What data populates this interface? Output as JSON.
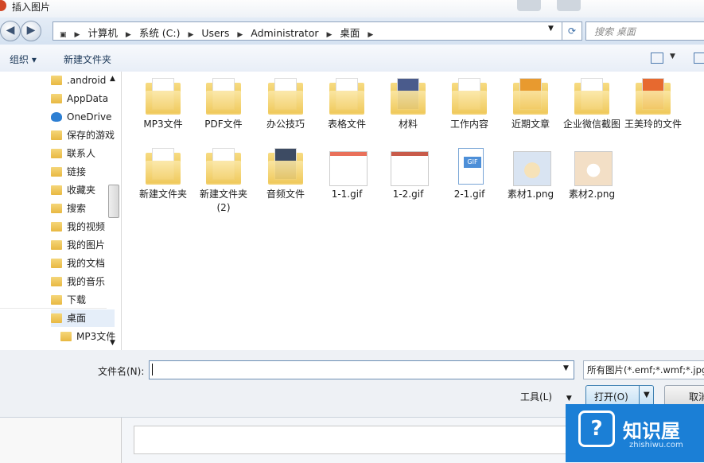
{
  "window": {
    "title": "插入图片"
  },
  "address": {
    "crumbs": [
      "计算机",
      "系统 (C:)",
      "Users",
      "Administrator",
      "桌面"
    ],
    "search_placeholder": "搜索 桌面"
  },
  "toolbar": {
    "organize": "组织 ▾",
    "new_folder": "新建文件夹"
  },
  "nav": {
    "items": [
      {
        "label": ".android",
        "icon": "folder-icon"
      },
      {
        "label": "AppData",
        "icon": "folder-icon"
      },
      {
        "label": "OneDrive",
        "icon": "onedrive-icon"
      },
      {
        "label": "保存的游戏",
        "icon": "folder-icon"
      },
      {
        "label": "联系人",
        "icon": "contacts-icon"
      },
      {
        "label": "链接",
        "icon": "links-icon"
      },
      {
        "label": "收藏夹",
        "icon": "favorites-icon"
      },
      {
        "label": "搜索",
        "icon": "search-folder-icon"
      },
      {
        "label": "我的视频",
        "icon": "folder-icon"
      },
      {
        "label": "我的图片",
        "icon": "folder-icon"
      },
      {
        "label": "我的文档",
        "icon": "folder-icon"
      },
      {
        "label": "我的音乐",
        "icon": "folder-icon"
      },
      {
        "label": "下载",
        "icon": "download-folder-icon"
      },
      {
        "label": "桌面",
        "icon": "desktop-folder-icon"
      },
      {
        "label": "MP3文件",
        "icon": "folder-icon"
      }
    ]
  },
  "files": [
    {
      "label": "MP3文件",
      "kind": "folder"
    },
    {
      "label": "PDF文件",
      "kind": "folder"
    },
    {
      "label": "办公技巧",
      "kind": "folder"
    },
    {
      "label": "表格文件",
      "kind": "folder"
    },
    {
      "label": "材料",
      "kind": "folder"
    },
    {
      "label": "工作内容",
      "kind": "folder"
    },
    {
      "label": "近期文章",
      "kind": "folder"
    },
    {
      "label": "企业微信截图",
      "kind": "folder"
    },
    {
      "label": "王美玲的文件",
      "kind": "folder"
    },
    {
      "label": "新建文件夹",
      "kind": "folder"
    },
    {
      "label": "新建文件夹 (2)",
      "kind": "folder"
    },
    {
      "label": "音频文件",
      "kind": "folder"
    },
    {
      "label": "1-1.gif",
      "kind": "image"
    },
    {
      "label": "1-2.gif",
      "kind": "image"
    },
    {
      "label": "2-1.gif",
      "kind": "gif"
    },
    {
      "label": "素材1.png",
      "kind": "image"
    },
    {
      "label": "素材2.png",
      "kind": "image"
    }
  ],
  "footer": {
    "filename_label": "文件名(N):",
    "filename_value": "",
    "filter": "所有图片(*.emf;*.wmf;*.jpg",
    "tools": "工具(L)",
    "open": "打开(O)",
    "cancel": "取消"
  },
  "watermark": {
    "name": "知识屋",
    "site": "zhishiwu.com",
    "badge": "?"
  },
  "gif_tag": "GIF"
}
